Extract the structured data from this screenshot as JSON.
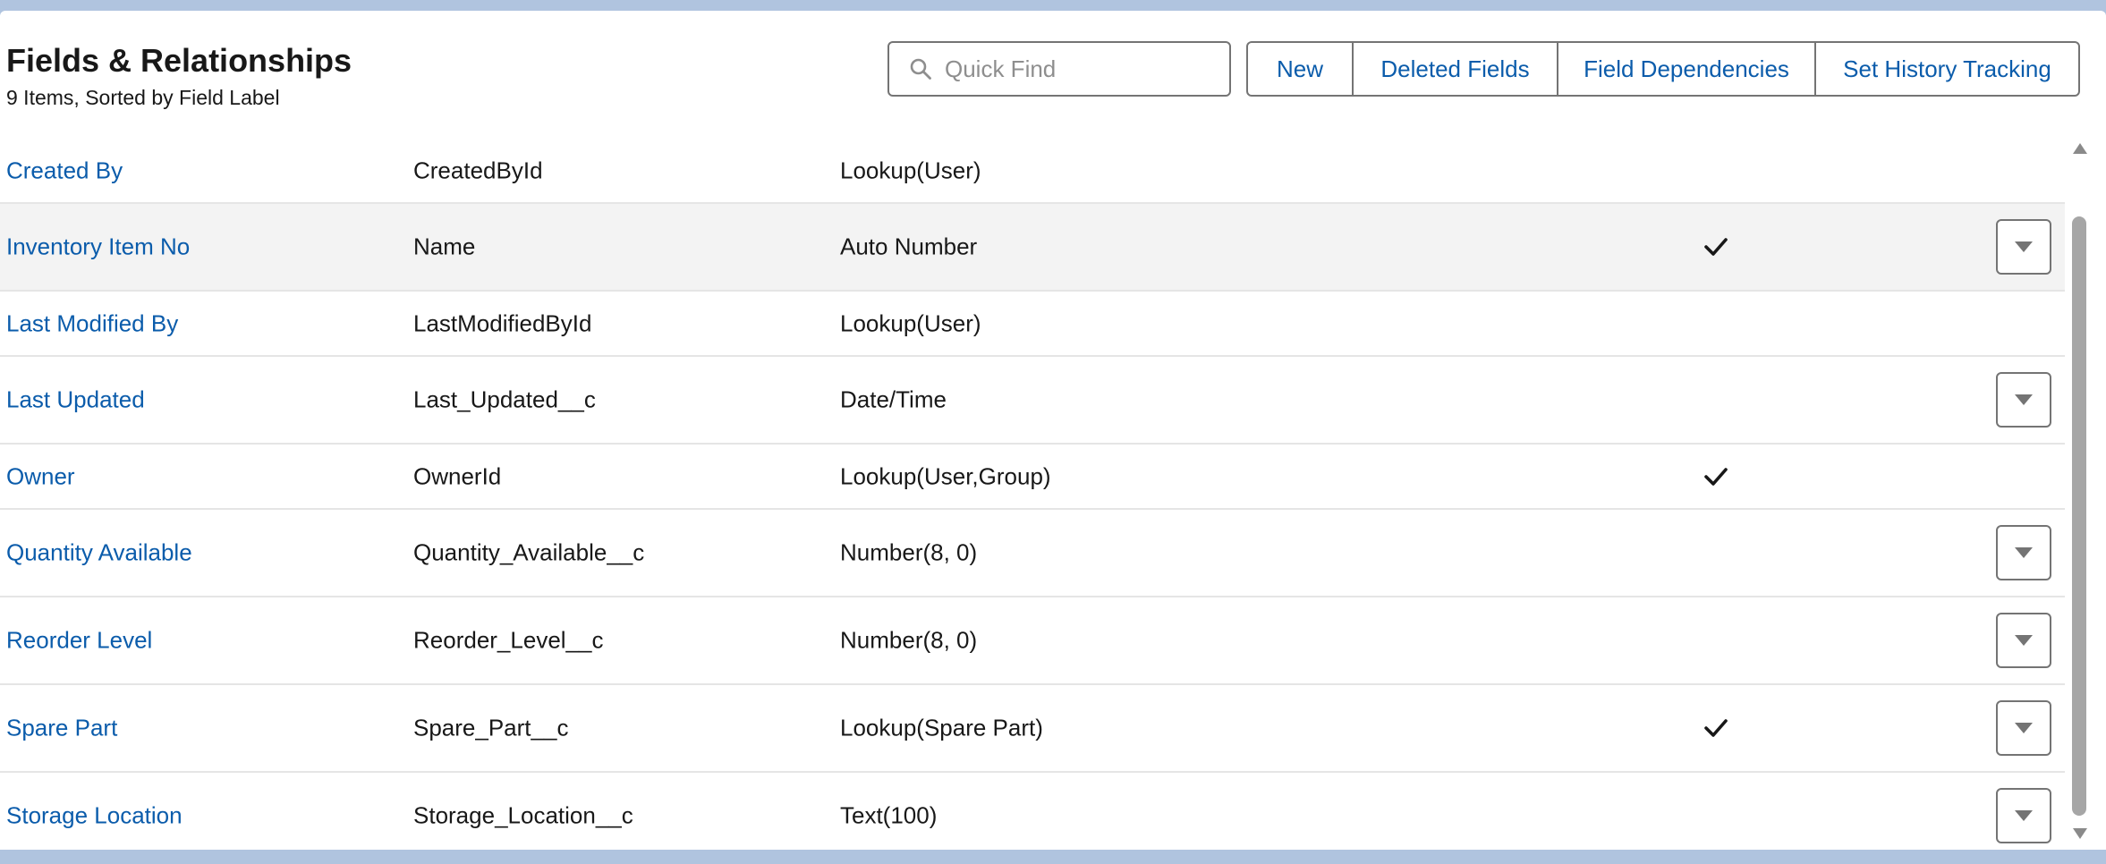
{
  "header": {
    "title": "Fields & Relationships",
    "subtitle": "9 Items, Sorted by Field Label"
  },
  "search": {
    "placeholder": "Quick Find",
    "value": "",
    "icon": "search-icon"
  },
  "toolbar": {
    "new_label": "New",
    "deleted_fields_label": "Deleted Fields",
    "field_dependencies_label": "Field Dependencies",
    "set_history_tracking_label": "Set History Tracking"
  },
  "fields": [
    {
      "label": "Created By",
      "api_name": "CreatedById",
      "data_type": "Lookup(User)",
      "indexed": false,
      "has_menu": false
    },
    {
      "label": "Inventory Item No",
      "api_name": "Name",
      "data_type": "Auto Number",
      "indexed": true,
      "has_menu": true
    },
    {
      "label": "Last Modified By",
      "api_name": "LastModifiedById",
      "data_type": "Lookup(User)",
      "indexed": false,
      "has_menu": false
    },
    {
      "label": "Last Updated",
      "api_name": "Last_Updated__c",
      "data_type": "Date/Time",
      "indexed": false,
      "has_menu": true
    },
    {
      "label": "Owner",
      "api_name": "OwnerId",
      "data_type": "Lookup(User,Group)",
      "indexed": true,
      "has_menu": false
    },
    {
      "label": "Quantity Available",
      "api_name": "Quantity_Available__c",
      "data_type": "Number(8, 0)",
      "indexed": false,
      "has_menu": true
    },
    {
      "label": "Reorder Level",
      "api_name": "Reorder_Level__c",
      "data_type": "Number(8, 0)",
      "indexed": false,
      "has_menu": true
    },
    {
      "label": "Spare Part",
      "api_name": "Spare_Part__c",
      "data_type": "Lookup(Spare Part)",
      "indexed": true,
      "has_menu": true
    },
    {
      "label": "Storage Location",
      "api_name": "Storage_Location__c",
      "data_type": "Text(100)",
      "indexed": false,
      "has_menu": true
    }
  ],
  "colors": {
    "link": "#0b5cab",
    "text": "#181818",
    "border": "#747474",
    "hover_row": "#f3f3f3",
    "backdrop": "#b0c4df"
  }
}
